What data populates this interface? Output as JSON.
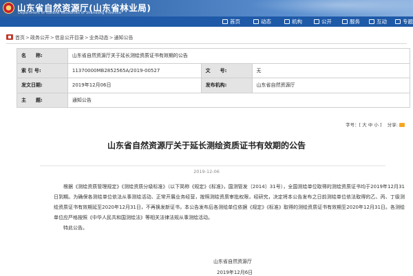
{
  "header": {
    "site_title": "山东省自然资源厅(山东省林业局)",
    "site_subtitle": "Department of Natural Resources of Shandong Province"
  },
  "nav": {
    "items": [
      {
        "label": "首页",
        "icon": "home-icon"
      },
      {
        "label": "动态",
        "icon": "news-icon"
      },
      {
        "label": "机构",
        "icon": "organization-icon"
      },
      {
        "label": "公开",
        "icon": "disclosure-icon"
      },
      {
        "label": "服务",
        "icon": "service-icon"
      },
      {
        "label": "互动",
        "icon": "interaction-icon"
      },
      {
        "label": "专题",
        "icon": "topic-icon"
      }
    ]
  },
  "breadcrumb": {
    "items": [
      "首页",
      "政务公开",
      "信息公开目录",
      "业务动态",
      "通知公告"
    ],
    "separator": ">"
  },
  "info_table": {
    "name_label": "名　　称:",
    "name_value": "山东省自然资源厅关于延长测绘资质证书有效期的公告",
    "index_label": "索 引 号:",
    "index_value": "11370000MB2852565A/2019-00527",
    "docno_label": "文　　号:",
    "docno_value": "无",
    "date_label": "发文日期:",
    "date_value": "2019年12月06日",
    "org_label": "发布机构:",
    "org_value": "山东省自然资源厅",
    "topic_label": "主　　题:",
    "topic_value": "通知公告"
  },
  "tools": {
    "font_prefix": "字号：[",
    "font_large": "大",
    "font_medium": "中",
    "font_small": "小",
    "font_suffix": "]",
    "share_label": "分享:"
  },
  "article": {
    "title": "山东省自然资源厅关于延长测绘资质证书有效期的公告",
    "date": "2019-12-06",
    "paragraph1": "根据《测绘资质管理规定》《测绘资质分级标准》（以下简称《规定》《标准》，国测管发〔2014〕31号），全国测绘单位取得的测绘资质证书均于2019年12月31日到期。为确保各测绘单位依法从事测绘活动、正常开展业务经营，按照测绘资质审批权限，经研究，决定将本公告发布之日前测绘单位依法取得的乙、丙、丁级测绘资质证书有效期延至2020年12月31日，不再换发新证书，本公告发布后各测绘单位依据《规定》《标准》取得的测绘资质证书有效期至2020年12月31日。各测绘单位应严格按照《中华人民共和国测绘法》等相关法律法规从事测绘活动。",
    "paragraph2": "特此公告。",
    "sign_org": "山东省自然资源厅",
    "sign_date": "2019年12月6日"
  },
  "colors": {
    "banner_blue": "#2f5f9e",
    "nav_blue": "#1f5aa8",
    "label_gray": "#e4e4e4"
  }
}
